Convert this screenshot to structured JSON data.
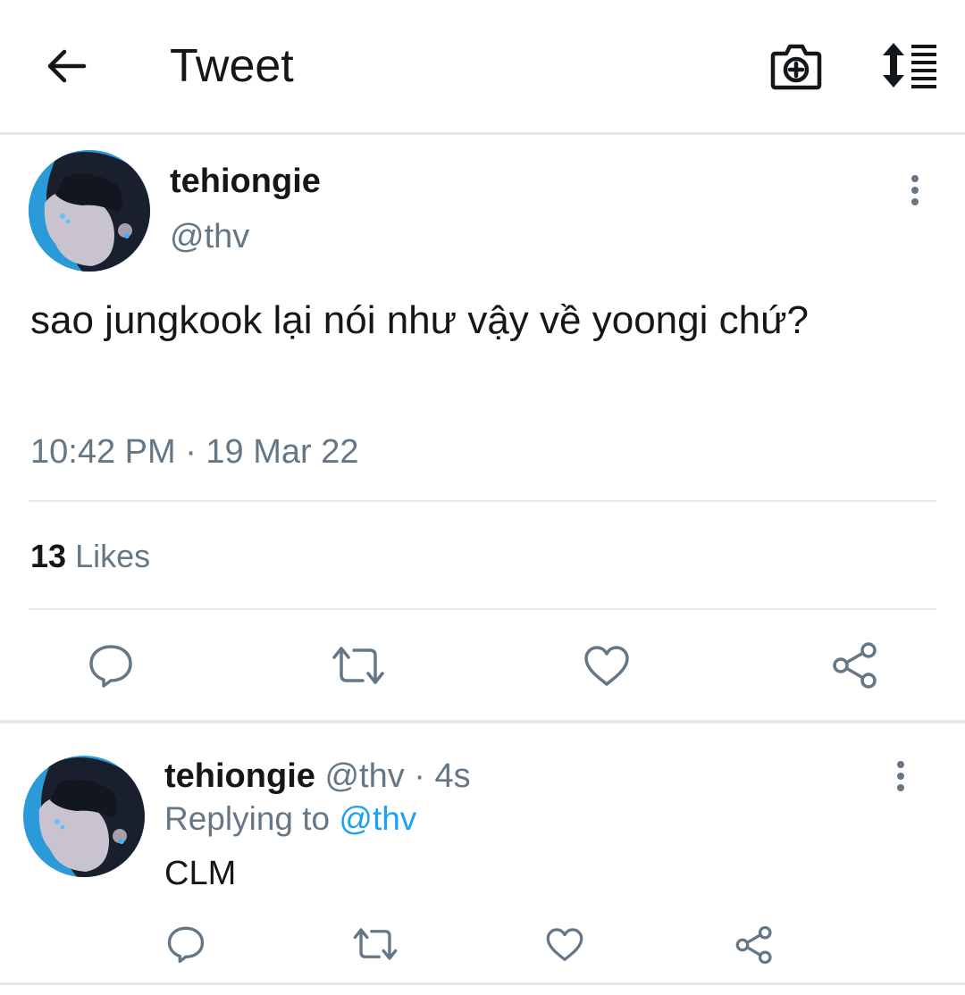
{
  "header": {
    "title": "Tweet",
    "back_icon": "arrow-left-icon",
    "camera_icon": "camera-plus-icon",
    "sort_icon": "sort-list-icon"
  },
  "tweet": {
    "display_name": "tehiongie",
    "handle": "@thv",
    "text": "sao jungkook lại nói như vậy về yoongi chứ?",
    "timestamp": "10:42 PM · 19 Mar 22",
    "likes_count": "13",
    "likes_label": "Likes",
    "actions": [
      "reply-icon",
      "retweet-icon",
      "like-icon",
      "share-icon"
    ]
  },
  "reply": {
    "display_name": "tehiongie",
    "handle_time": "@thv · 4s",
    "replying_prefix": "Replying to",
    "replying_handle": "@thv",
    "text": "CLM",
    "actions": [
      "reply-icon",
      "retweet-icon",
      "like-icon",
      "share-icon"
    ]
  },
  "colors": {
    "text": "#14171a",
    "secondary": "#657786",
    "link": "#1da1f2",
    "divider": "#e6e9ec"
  }
}
